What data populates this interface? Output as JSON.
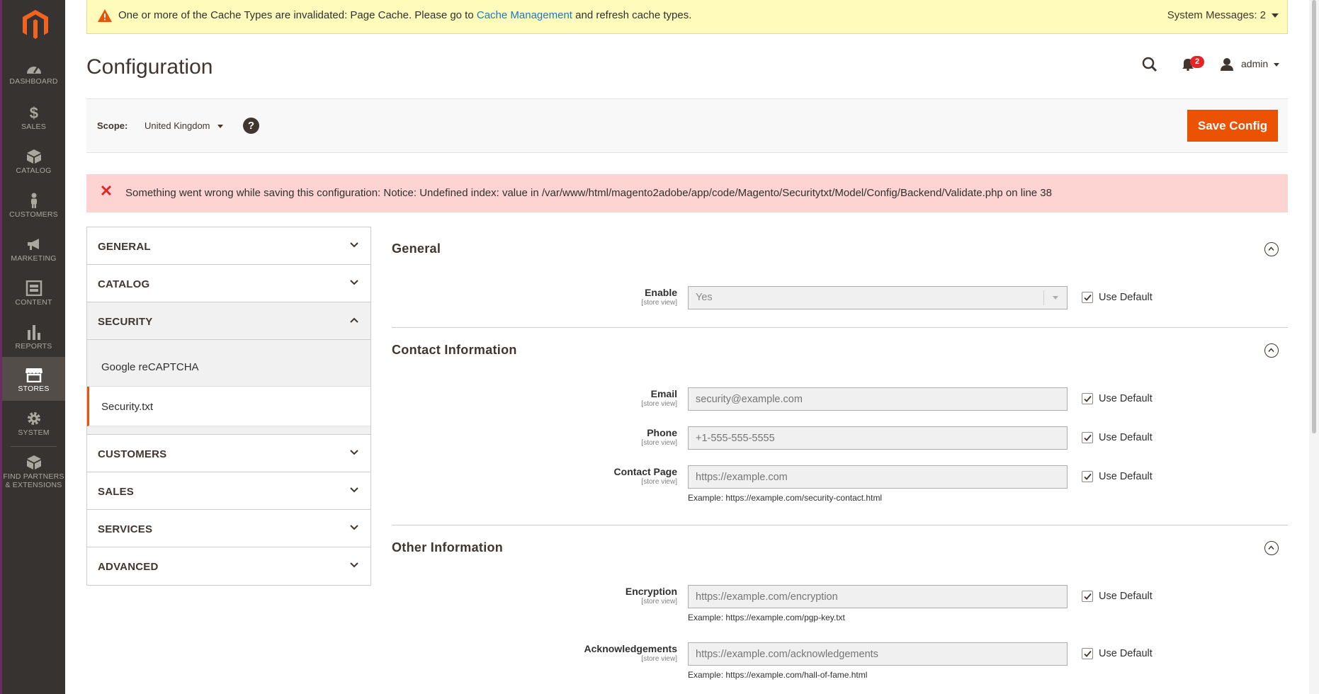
{
  "nav": {
    "items": [
      {
        "label": "DASHBOARD",
        "icon": "dashboard-icon"
      },
      {
        "label": "SALES",
        "icon": "dollar-icon"
      },
      {
        "label": "CATALOG",
        "icon": "box-icon"
      },
      {
        "label": "CUSTOMERS",
        "icon": "person-icon"
      },
      {
        "label": "MARKETING",
        "icon": "megaphone-icon"
      },
      {
        "label": "CONTENT",
        "icon": "content-icon"
      },
      {
        "label": "REPORTS",
        "icon": "bar-chart-icon"
      },
      {
        "label": "STORES",
        "icon": "store-icon"
      },
      {
        "label": "SYSTEM",
        "icon": "gear-icon"
      },
      {
        "label": "FIND PARTNERS",
        "label2": "& EXTENSIONS",
        "icon": "extensions-icon"
      }
    ],
    "active": "STORES"
  },
  "system_message": {
    "text_before": "One or more of the Cache Types are invalidated: Page Cache. Please go to ",
    "link": "Cache Management",
    "text_after": " and refresh cache types.",
    "count": "System Messages: 2"
  },
  "header": {
    "title": "Configuration",
    "notifications": "2",
    "user": "admin"
  },
  "scope": {
    "label": "Scope:",
    "value": "United Kingdom",
    "help": "?",
    "save_label": "Save Config"
  },
  "error": {
    "text": "Something went wrong while saving this configuration: Notice: Undefined index: value in /var/www/html/magento2adobe/app/code/Magento/Securitytxt/Model/Config/Backend/Validate.php on line 38"
  },
  "tabs": {
    "general": "GENERAL",
    "catalog": "CATALOG",
    "security": "SECURITY",
    "sub": [
      "Google reCAPTCHA",
      "Security.txt"
    ],
    "customers": "CUSTOMERS",
    "sales": "SALES",
    "services": "SERVICES",
    "advanced": "ADVANCED"
  },
  "sections": {
    "general": {
      "title": "General",
      "enable_label": "Enable",
      "enable_scope": "[store view]",
      "enable_value": "Yes",
      "use_default": "Use Default"
    },
    "contact": {
      "title": "Contact Information",
      "email_label": "Email",
      "email_placeholder": "security@example.com",
      "phone_label": "Phone",
      "phone_placeholder": "+1-555-555-5555",
      "page_label": "Contact Page",
      "page_placeholder": "https://example.com",
      "page_note": "Example: https://example.com/security-contact.html",
      "scope": "[store view]",
      "use_default": "Use Default"
    },
    "other": {
      "title": "Other Information",
      "enc_label": "Encryption",
      "enc_placeholder": "https://example.com/encryption",
      "enc_note": "Example: https://example.com/pgp-key.txt",
      "ack_label": "Acknowledgements",
      "ack_placeholder": "https://example.com/acknowledgements",
      "ack_note": "Example: https://example.com/hall-of-fame.html",
      "scope": "[store view]",
      "use_default": "Use Default"
    }
  },
  "colors": {
    "nav_bg": "#373330",
    "accent": "#eb5202",
    "link": "#1979c3",
    "error_bg": "#fdd4d1",
    "warning_bg": "#fffbbb"
  }
}
